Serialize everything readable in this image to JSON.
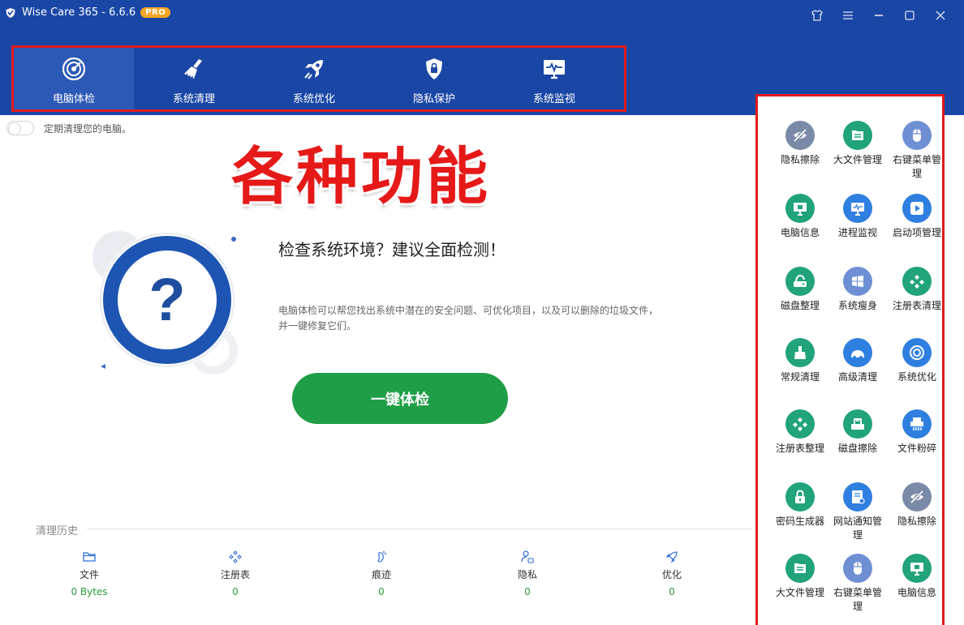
{
  "app": {
    "title": "Wise Care 365 - 6.6.6",
    "badge": "PRO"
  },
  "window_controls": [
    "skin-icon",
    "menu-icon",
    "minimize-icon",
    "maximize-icon",
    "close-icon"
  ],
  "nav": {
    "tabs": [
      {
        "label": "电脑体检",
        "icon": "radar-icon",
        "active": true
      },
      {
        "label": "系统清理",
        "icon": "broom-icon",
        "active": false
      },
      {
        "label": "系统优化",
        "icon": "rocket-icon",
        "active": false
      },
      {
        "label": "隐私保护",
        "icon": "shield-lock-icon",
        "active": false
      },
      {
        "label": "系统监视",
        "icon": "monitor-pulse-icon",
        "active": false
      }
    ]
  },
  "main": {
    "toggle_label": "定期清理您的电脑。",
    "overlay": "各种功能",
    "check_title": "检查系统环境？建议全面检测！",
    "check_desc": "电脑体检可以帮您找出系统中潜在的安全问题、可优化项目，以及可以删除的垃圾文件，并一键修复它们。",
    "scan_button": "一键体检"
  },
  "history": {
    "label": "清理历史",
    "items": [
      {
        "label": "文件",
        "value": "0 Bytes",
        "icon": "folder-icon"
      },
      {
        "label": "注册表",
        "value": "0",
        "icon": "registry-icon"
      },
      {
        "label": "痕迹",
        "value": "0",
        "icon": "footprint-icon"
      },
      {
        "label": "隐私",
        "value": "0",
        "icon": "user-lock-icon"
      },
      {
        "label": "优化",
        "value": "0",
        "icon": "rocket-icon"
      }
    ]
  },
  "tools": [
    {
      "label": "隐私擦除",
      "icon": "eye-off-icon",
      "color": "#7a8aa6"
    },
    {
      "label": "大文件管理",
      "icon": "file-list-icon",
      "color": "#21a37b"
    },
    {
      "label": "右键菜单管理",
      "icon": "mouse-icon",
      "color": "#6e8fd3"
    },
    {
      "label": "电脑信息",
      "icon": "computer-icon",
      "color": "#21a37b"
    },
    {
      "label": "进程监视",
      "icon": "process-monitor-icon",
      "color": "#2f7fe0"
    },
    {
      "label": "启动项管理",
      "icon": "play-icon",
      "color": "#2f7fe0"
    },
    {
      "label": "磁盘整理",
      "icon": "disk-icon",
      "color": "#21a37b"
    },
    {
      "label": "系统瘦身",
      "icon": "windows-icon",
      "color": "#6e8fd3"
    },
    {
      "label": "注册表清理",
      "icon": "registry-icon",
      "color": "#21a37b"
    },
    {
      "label": "常规清理",
      "icon": "brush-icon",
      "color": "#21a37b"
    },
    {
      "label": "高级清理",
      "icon": "vacuum-icon",
      "color": "#2f7fe0"
    },
    {
      "label": "系统优化",
      "icon": "gear-icon",
      "color": "#2f7fe0"
    },
    {
      "label": "注册表整理",
      "icon": "registry-icon",
      "color": "#21a37b"
    },
    {
      "label": "磁盘擦除",
      "icon": "disk-erase-icon",
      "color": "#21a37b"
    },
    {
      "label": "文件粉碎",
      "icon": "shredder-icon",
      "color": "#2f7fe0"
    },
    {
      "label": "密码生成器",
      "icon": "lock-icon",
      "color": "#21a37b"
    },
    {
      "label": "网站通知管理",
      "icon": "notification-icon",
      "color": "#2f7fe0"
    },
    {
      "label": "隐私擦除",
      "icon": "eye-off-icon",
      "color": "#7a8aa6"
    },
    {
      "label": "大文件管理",
      "icon": "file-list-icon",
      "color": "#21a37b"
    },
    {
      "label": "右键菜单管理",
      "icon": "mouse-icon",
      "color": "#6e8fd3"
    },
    {
      "label": "电脑信息",
      "icon": "computer-icon",
      "color": "#21a37b"
    }
  ],
  "colors": {
    "header": "#1a47a6",
    "accent_green": "#1f9e47",
    "highlight_red": "#e21a1a"
  }
}
